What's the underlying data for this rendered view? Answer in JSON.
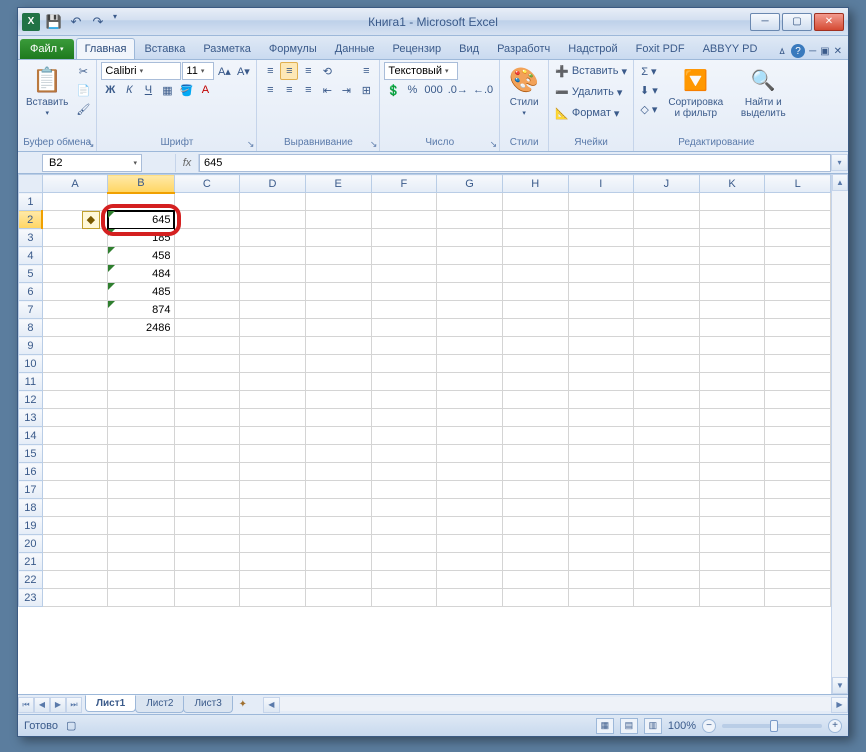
{
  "title": "Книга1 - Microsoft Excel",
  "qat": {
    "save": "💾",
    "undo": "↶",
    "redo": "↷"
  },
  "tabs": {
    "file": "Файл",
    "items": [
      "Главная",
      "Вставка",
      "Разметка",
      "Формулы",
      "Данные",
      "Рецензир",
      "Вид",
      "Разработч",
      "Надстрой",
      "Foxit PDF",
      "ABBYY PD"
    ],
    "active_index": 0
  },
  "ribbon": {
    "clipboard": {
      "paste": "Вставить",
      "label": "Буфер обмена"
    },
    "font": {
      "name": "Calibri",
      "size": "11",
      "bold": "Ж",
      "italic": "К",
      "underline": "Ч",
      "label": "Шрифт"
    },
    "align": {
      "label": "Выравнивание",
      "wrap": "≡",
      "merge": "⊞"
    },
    "number": {
      "format": "Текстовый",
      "label": "Число"
    },
    "styles": {
      "label": "Стили",
      "styles_btn": "Стили"
    },
    "cells": {
      "insert": "Вставить",
      "delete": "Удалить",
      "format": "Формат",
      "label": "Ячейки"
    },
    "editing": {
      "sort": "Сортировка и фильтр",
      "find": "Найти и выделить",
      "label": "Редактирование"
    }
  },
  "formula_bar": {
    "name_box": "B2",
    "fx": "fx",
    "value": "645"
  },
  "columns": [
    "A",
    "B",
    "C",
    "D",
    "E",
    "F",
    "G",
    "H",
    "I",
    "J",
    "K",
    "L"
  ],
  "rows": 23,
  "cells": {
    "B2": "645",
    "B3": "185",
    "B4": "458",
    "B5": "484",
    "B6": "485",
    "B7": "874",
    "B8": "2486"
  },
  "text_cells": [
    "B2",
    "B3",
    "B4",
    "B5",
    "B6",
    "B7"
  ],
  "selected_cell": "B2",
  "sheet_tabs": {
    "items": [
      "Лист1",
      "Лист2",
      "Лист3"
    ],
    "active": 0
  },
  "status": {
    "ready": "Готово",
    "zoom": "100%"
  }
}
